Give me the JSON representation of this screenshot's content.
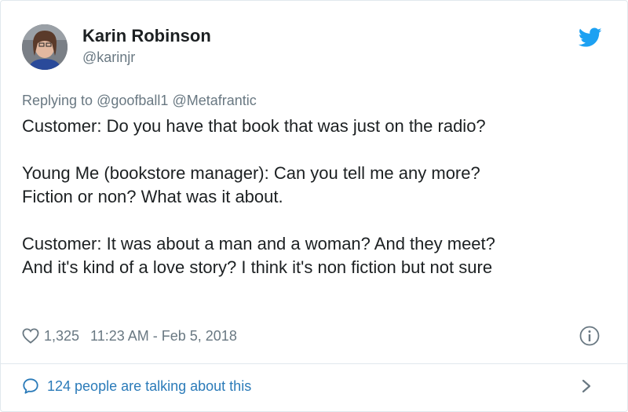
{
  "author": {
    "name": "Karin Robinson",
    "handle": "@karinjr",
    "avatar_icon": "profile-photo"
  },
  "reply": {
    "prefix": "Replying to",
    "mentions": [
      "@goofball1",
      "@Metafrantic"
    ]
  },
  "tweet": {
    "paragraphs": [
      [
        "Customer: Do you have that book that was just on the radio?"
      ],
      [
        "Young Me (bookstore manager): Can you tell me any more?",
        "Fiction or non?  What was it about."
      ],
      [
        "Customer: It was about a man and a woman? And they meet?",
        "And it's kind of a love story? I think it's non fiction but not sure"
      ]
    ]
  },
  "meta": {
    "likes": "1,325",
    "timestamp": "11:23 AM - Feb 5, 2018",
    "heart_icon": "heart-outline",
    "info_icon": "info-circle"
  },
  "footer": {
    "talking_label": "124 people are talking about this",
    "bubble_icon": "speech-bubble",
    "chevron_icon": "chevron-right"
  },
  "colors": {
    "twitter_blue": "#1da1f2",
    "link_blue": "#2b7bb9",
    "muted_gray": "#697882",
    "text": "#1c2022",
    "border": "#e1e8ed"
  }
}
